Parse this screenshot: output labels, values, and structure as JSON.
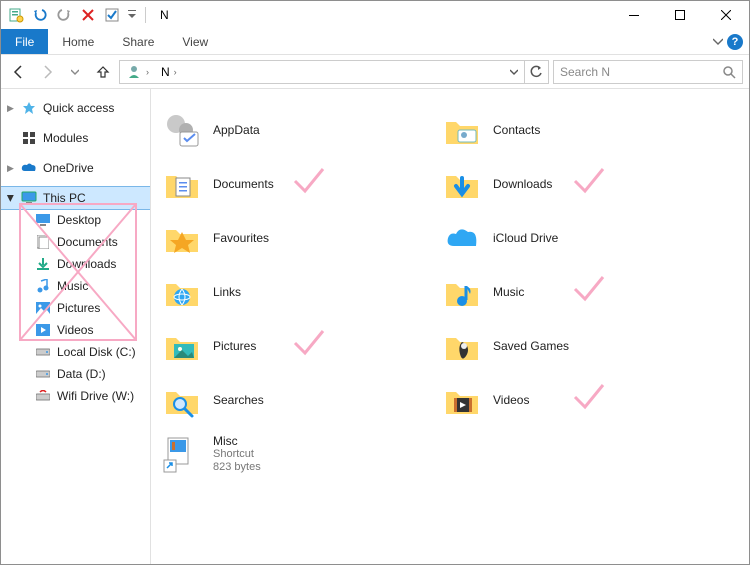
{
  "window": {
    "title": "N"
  },
  "ribbon": {
    "tabs": {
      "file": "File",
      "home": "Home",
      "share": "Share",
      "view": "View"
    }
  },
  "address": {
    "segments": [
      "N"
    ],
    "dropdown_visible": true
  },
  "search": {
    "placeholder": "Search N"
  },
  "sidebar": {
    "quick_access": "Quick access",
    "modules": "Modules",
    "onedrive": "OneDrive",
    "this_pc": "This PC",
    "subs": {
      "desktop": "Desktop",
      "documents": "Documents",
      "downloads": "Downloads",
      "music": "Music",
      "pictures": "Pictures",
      "videos": "Videos",
      "local_disk": "Local Disk (C:)",
      "data": "Data (D:)",
      "wifi_drive": "Wifi Drive (W:)"
    }
  },
  "items": [
    {
      "label": "AppData"
    },
    {
      "label": "Contacts"
    },
    {
      "label": "Documents",
      "checked": true
    },
    {
      "label": "Downloads",
      "checked": true
    },
    {
      "label": "Favourites"
    },
    {
      "label": "iCloud Drive"
    },
    {
      "label": "Links"
    },
    {
      "label": "Music",
      "checked": true
    },
    {
      "label": "Pictures",
      "checked": true
    },
    {
      "label": "Saved Games"
    },
    {
      "label": "Searches"
    },
    {
      "label": "Videos",
      "checked": true
    },
    {
      "label": "Misc",
      "sub1": "Shortcut",
      "sub2": "823 bytes"
    }
  ]
}
